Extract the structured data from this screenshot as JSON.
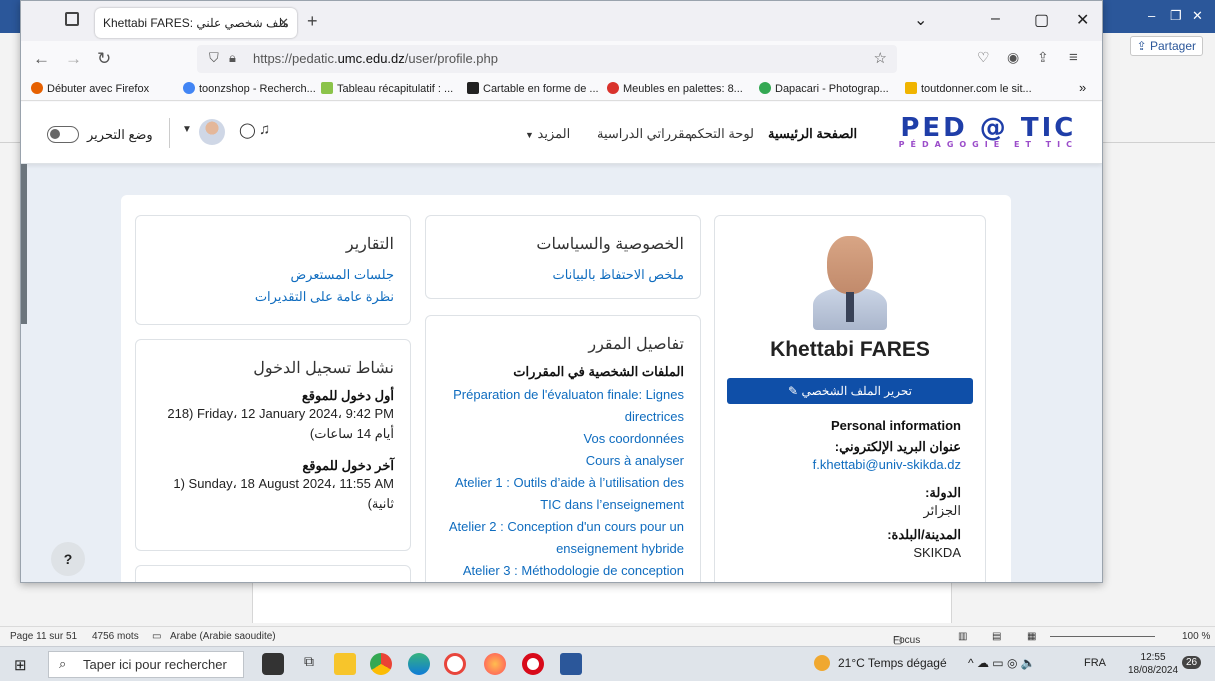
{
  "word": {
    "share_label": "Partager",
    "status": {
      "page": "Page 11 sur 51",
      "words": "4756 mots",
      "language": "Arabe (Arabie saoudite)",
      "focus": "Focus",
      "zoom": "100 %"
    }
  },
  "taskbar": {
    "search_placeholder": "Taper ici pour rechercher",
    "weather": "21°C  Temps dégagé",
    "lang": "FRA",
    "time": "12:55",
    "date": "18/08/2024",
    "notif_count": "26"
  },
  "browser": {
    "tab_title": "Khettabi FARES: ملف شخصي علني",
    "url_prefix": "https://pedatic.",
    "url_domain": "umc.edu.dz",
    "url_path": "/user/profile.php",
    "bookmarks": [
      {
        "label": "Débuter avec Firefox",
        "color": "#e66000"
      },
      {
        "label": "toonzshop - Recherch...",
        "color": "#4285f4"
      },
      {
        "label": "Tableau récapitulatif : ...",
        "color": "#8bc34a"
      },
      {
        "label": "Cartable en forme de ...",
        "color": "#222222"
      },
      {
        "label": "Meubles en palettes: 8...",
        "color": "#d9322c"
      },
      {
        "label": "Dapacari - Photograp...",
        "color": "#34a853"
      },
      {
        "label": "toutdonner.com le sit...",
        "color": "#f0b400"
      }
    ]
  },
  "moodle": {
    "logo_big": "PED @ TIC",
    "logo_small": "PÉDAGOGIE ET TIC",
    "nav": {
      "home": "الصفحة الرئيسية",
      "dashboard": "لوحة التحكم",
      "courses": "مقرراتي الدراسية",
      "more": "المزيد"
    },
    "edit_mode": "وضع التحرير",
    "help": "?",
    "reports": {
      "title": "التقارير",
      "links": [
        "جلسات المستعرض",
        "نظرة عامة على التقديرات"
      ]
    },
    "privacy": {
      "title": "الخصوصية والسياسات",
      "links": [
        "ملخص الاحتفاظ بالبيانات"
      ]
    },
    "login": {
      "title": "نشاط تسجيل الدخول",
      "first_label": "أول دخول للموقع",
      "first_value": "218)  Friday، 12 January 2024، 9:42 PM",
      "first_ago": "أيام 14 ساعات)",
      "last_label": "آخر دخول للموقع",
      "last_value": "1)  Sunday، 18 August 2024، 11:55 AM",
      "last_ago": "ثانية)"
    },
    "course_details": {
      "title": "تفاصيل المقرر",
      "profiles_label": "الملفات الشخصية في المقررات",
      "courses": [
        "Préparation de l'évaluaton finale: Lignes directrices",
        "Vos coordonnées",
        "Cours à analyser",
        "Atelier 1 : Outils d’aide à l’utilisation des TIC dans l’enseignement",
        "Atelier 2 : Conception d'un cours pour un enseignement hybride",
        "Atelier 3 : Méthodologie de conception"
      ]
    },
    "profile": {
      "name": "Khettabi FARES",
      "edit_btn": "تحرير الملف الشخصي",
      "pi_title": "Personal information",
      "email_label": "عنوان البريد الإلكتروني:",
      "email": "f.khettabi@univ-skikda.dz",
      "country_label": "الدولة:",
      "country": "الجزائر",
      "city_label": "المدينة/البلدة:",
      "city": "SKIKDA"
    }
  }
}
